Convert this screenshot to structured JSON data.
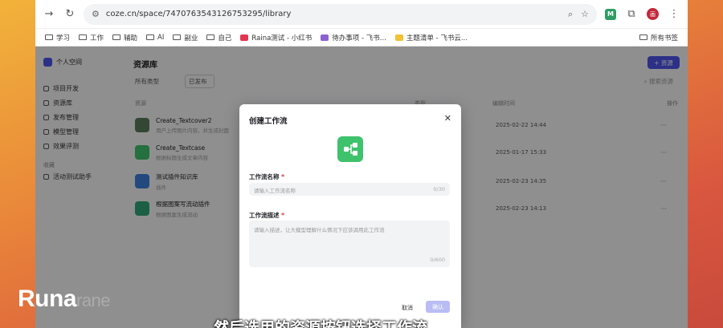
{
  "browser": {
    "url": "coze.cn/space/7470763543126753295/library",
    "avatar_letter": "画",
    "extension_letter": "M"
  },
  "bookmarks": [
    {
      "label": "学习",
      "icon": "folder-icon"
    },
    {
      "label": "工作",
      "icon": "folder-icon"
    },
    {
      "label": "辅助",
      "icon": "folder-icon"
    },
    {
      "label": "AI",
      "icon": "folder-icon"
    },
    {
      "label": "副业",
      "icon": "folder-icon"
    },
    {
      "label": "自己",
      "icon": "folder-icon"
    },
    {
      "label": "Raina测试 - 小红书",
      "icon": "xiaohongshu-icon",
      "color": "#e0364f"
    },
    {
      "label": "待办事项 - 飞书...",
      "icon": "feishu-icon",
      "color": "#8a63d2"
    },
    {
      "label": "主题清单 - 飞书云...",
      "icon": "feishu-doc-icon",
      "color": "#f1c232"
    }
  ],
  "bookmarks_right": "所有书签",
  "sidebar": {
    "space": "个人空间",
    "items": [
      "项目开发",
      "资源库",
      "发布管理",
      "模型管理",
      "效果评测"
    ],
    "section": "收藏",
    "section_items": [
      "活动测试助手"
    ]
  },
  "main": {
    "title": "资源库",
    "add_button": "+ 资源",
    "filter_type": "所有类型",
    "filter_status": "已发布",
    "search_placeholder": "搜索资源",
    "columns": [
      "资源",
      "类型",
      "编辑时间",
      "操作"
    ],
    "rows": [
      {
        "name": "Create_Textcover2",
        "desc": "用户上传图片内容，并生成封面",
        "time": "2025-02-22 14:44",
        "color": "#5a7a5a"
      },
      {
        "name": "Create_Textcase",
        "desc": "根据标题生成文章内容",
        "time": "2025-01-17 15:33",
        "color": "#3ec26b"
      },
      {
        "name": "测试插件知识库",
        "desc": "插件",
        "time": "2025-02-23 14:35",
        "color": "#3d7fd9"
      },
      {
        "name": "根据图案写流动插件",
        "desc": "根据图案生成流动",
        "time": "2025-02-23 14:13",
        "color": "#2fa678"
      }
    ]
  },
  "modal": {
    "title": "创建工作流",
    "name_label": "工作流名称",
    "name_placeholder": "请输入工作流名称",
    "name_count": "0/30",
    "desc_label": "工作流描述",
    "desc_placeholder": "请输入描述，让大模型理解什么情况下应该调用此工作流",
    "desc_count": "0/600",
    "cancel": "取消",
    "confirm": "确认"
  },
  "watermark": {
    "main": "Runa",
    "faint": "rane"
  },
  "subtitle": "然后选用的资源按钮选择工作流"
}
